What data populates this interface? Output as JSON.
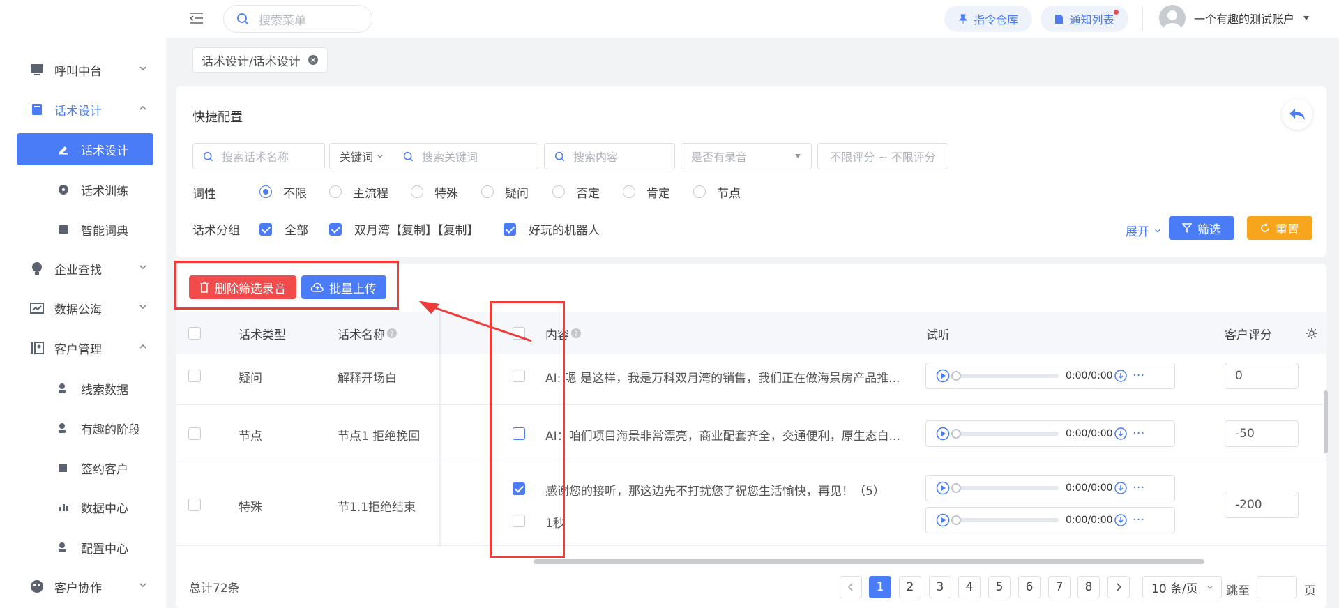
{
  "header": {
    "search_placeholder": "搜索菜单",
    "command_btn": "指令仓库",
    "notice_btn": "通知列表",
    "account_name": "一个有趣的测试账户"
  },
  "sidebar": {
    "items": [
      {
        "label": "呼叫中台",
        "icon": "monitor-icon"
      },
      {
        "label": "话术设计",
        "icon": "book-icon"
      },
      {
        "label": "话术设计",
        "icon": "edit-icon"
      },
      {
        "label": "话术训练",
        "icon": "chat-icon"
      },
      {
        "label": "智能词典",
        "icon": "dictionary-icon"
      },
      {
        "label": "企业查找",
        "icon": "bulb-icon"
      },
      {
        "label": "数据公海",
        "icon": "chart-icon"
      },
      {
        "label": "客户管理",
        "icon": "contacts-icon"
      },
      {
        "label": "线索数据",
        "icon": "user-search-icon"
      },
      {
        "label": "有趣的阶段",
        "icon": "user-x-icon"
      },
      {
        "label": "签约客户",
        "icon": "sign-icon"
      },
      {
        "label": "数据中心",
        "icon": "bar-icon"
      },
      {
        "label": "配置中心",
        "icon": "user-gear-icon"
      },
      {
        "label": "客户协作",
        "icon": "team-icon"
      }
    ]
  },
  "tabs": {
    "current": "话术设计/话术设计"
  },
  "filters": {
    "title": "快捷配置",
    "name_placeholder": "搜索话术名称",
    "keyword_select": "关键词",
    "keyword_placeholder": "搜索关键词",
    "content_placeholder": "搜索内容",
    "recording_placeholder": "是否有录音",
    "score_range": "不限评分 ~ 不限评分",
    "pos_label": "词性",
    "pos_options": [
      "不限",
      "主流程",
      "特殊",
      "疑问",
      "否定",
      "肯定",
      "节点"
    ],
    "group_label": "话术分组",
    "groups": [
      "全部",
      "双月湾【复制】【复制】",
      "好玩的机器人"
    ],
    "expand": "展开",
    "filter_btn": "筛选",
    "reset_btn": "重置"
  },
  "actions": {
    "delete_btn": "删除筛选录音",
    "upload_btn": "批量上传"
  },
  "table": {
    "headers": {
      "type": "话术类型",
      "name": "话术名称",
      "content": "内容",
      "listen": "试听",
      "score": "客户评分"
    },
    "rows": [
      {
        "type": "疑问",
        "name": "解释开场白",
        "content": "AI: 嗯 是这样，我是万科双月湾的销售，我们正在做海景房产品推...",
        "time": "0:00/0:00",
        "score": "0"
      },
      {
        "type": "节点",
        "name": "节点1 拒绝挽回",
        "content": "AI：咱们项目海景非常漂亮，商业配套齐全，交通便利，原生态白...",
        "time": "0:00/0:00",
        "score": "-50"
      },
      {
        "type": "特殊",
        "name": "节1.1拒绝结束",
        "content": "感谢您的接听，那这边先不打扰您了祝您生活愉快，再见！（5）",
        "content2": "1秒",
        "time": "0:00/0:00",
        "time2": "0:00/0:00",
        "score": "-200"
      }
    ]
  },
  "pagination": {
    "total": "总计72条",
    "pages": [
      "1",
      "2",
      "3",
      "4",
      "5",
      "6",
      "7",
      "8"
    ],
    "page_size": "10 条/页",
    "goto": "跳至",
    "page_unit": "页"
  },
  "colors": {
    "accent": "#4a7cf7",
    "danger": "#f24b4b",
    "warning": "#f7a51c",
    "annotation": "#f03b3b"
  }
}
